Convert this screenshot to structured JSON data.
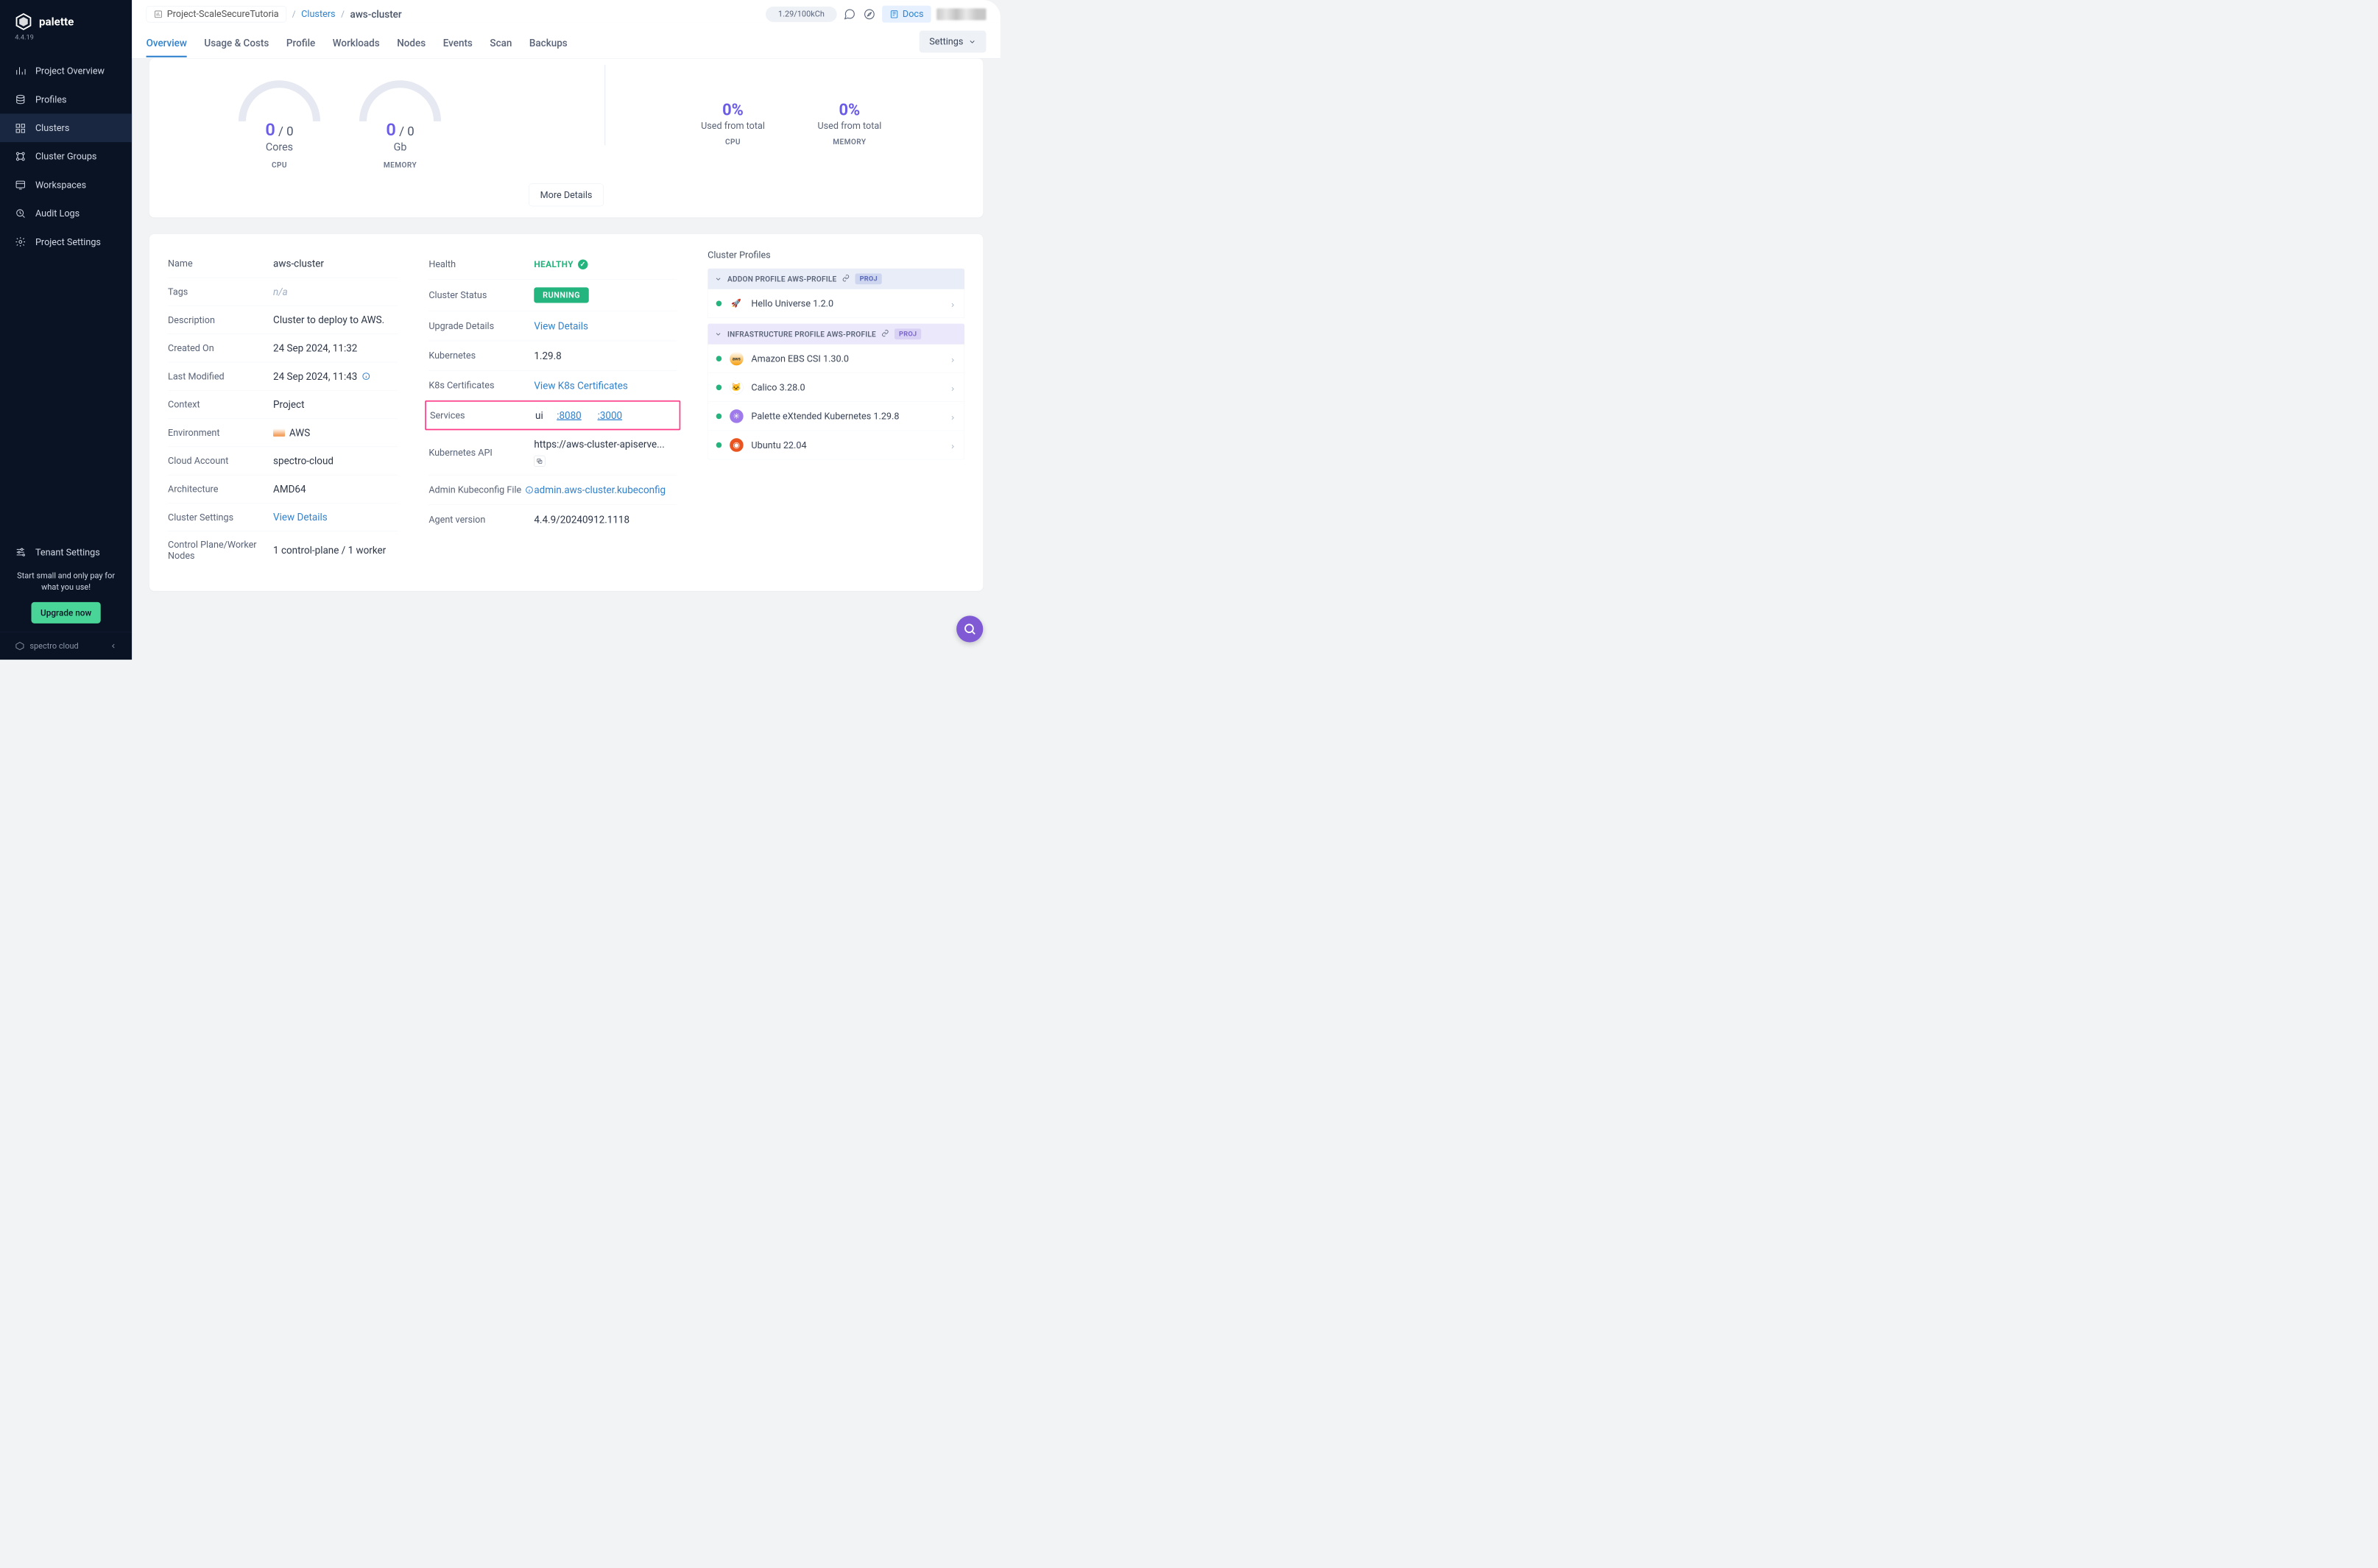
{
  "brand": {
    "name": "palette",
    "version": "4.4.19"
  },
  "sidebar": {
    "items": [
      {
        "label": "Project Overview"
      },
      {
        "label": "Profiles"
      },
      {
        "label": "Clusters"
      },
      {
        "label": "Cluster Groups"
      },
      {
        "label": "Workspaces"
      },
      {
        "label": "Audit Logs"
      },
      {
        "label": "Project Settings"
      }
    ],
    "tenant": "Tenant Settings",
    "promo": "Start small and only pay for what you use!",
    "upgrade": "Upgrade now",
    "footer": "spectro cloud"
  },
  "breadcrumb": {
    "project": "Project-ScaleSecureTutoria",
    "parent": "Clusters",
    "current": "aws-cluster"
  },
  "header": {
    "credits": "1.29/100kCh",
    "docs": "Docs"
  },
  "tabs": [
    {
      "label": "Overview",
      "active": true
    },
    {
      "label": "Usage & Costs"
    },
    {
      "label": "Profile"
    },
    {
      "label": "Workloads"
    },
    {
      "label": "Nodes"
    },
    {
      "label": "Events"
    },
    {
      "label": "Scan"
    },
    {
      "label": "Backups"
    }
  ],
  "settings": "Settings",
  "gauges": {
    "cpu": {
      "used": "0",
      "total": "0",
      "unit": "Cores",
      "label": "CPU"
    },
    "mem": {
      "used": "0",
      "total": "0",
      "unit": "Gb",
      "label": "MEMORY"
    },
    "pctCpu": {
      "value": "0%",
      "sub": "Used from total",
      "label": "CPU"
    },
    "pctMem": {
      "value": "0%",
      "sub": "Used from total",
      "label": "MEMORY"
    },
    "more": "More Details"
  },
  "left": {
    "name_k": "Name",
    "name_v": "aws-cluster",
    "tags_k": "Tags",
    "tags_v": "n/a",
    "desc_k": "Description",
    "desc_v": "Cluster to deploy to AWS.",
    "created_k": "Created On",
    "created_v": "24 Sep 2024, 11:32",
    "mod_k": "Last Modified",
    "mod_v": "24 Sep 2024, 11:43",
    "ctx_k": "Context",
    "ctx_v": "Project",
    "env_k": "Environment",
    "env_v": "AWS",
    "acct_k": "Cloud Account",
    "acct_v": "spectro-cloud",
    "arch_k": "Architecture",
    "arch_v": "AMD64",
    "cs_k": "Cluster Settings",
    "cs_v": "View Details",
    "nodes_k": "Control Plane/Worker Nodes",
    "nodes_v": "1 control-plane / 1 worker"
  },
  "mid": {
    "health_k": "Health",
    "health_v": "HEALTHY",
    "status_k": "Cluster Status",
    "status_v": "RUNNING",
    "upg_k": "Upgrade Details",
    "upg_v": "View Details",
    "k8s_k": "Kubernetes",
    "k8s_v": "1.29.8",
    "certs_k": "K8s Certificates",
    "certs_v": "View K8s Certificates",
    "svc_k": "Services",
    "svc_name": "ui",
    "svc_p1": ":8080",
    "svc_p2": ":3000",
    "api_k": "Kubernetes API",
    "api_v": "https://aws-cluster-apiserve...",
    "kube_k": "Admin Kubeconfig File",
    "kube_v": "admin.aws-cluster.kubeconfig",
    "agent_k": "Agent version",
    "agent_v": "4.4.9/20240912.1118"
  },
  "profiles": {
    "title": "Cluster Profiles",
    "addon_header": "ADDON PROFILE AWS-PROFILE",
    "infra_header": "INFRASTRUCTURE PROFILE AWS-PROFILE",
    "badge": "PROJ",
    "addon": [
      {
        "label": "Hello Universe 1.2.0"
      }
    ],
    "infra": [
      {
        "label": "Amazon EBS CSI 1.30.0"
      },
      {
        "label": "Calico 3.28.0"
      },
      {
        "label": "Palette eXtended Kubernetes 1.29.8"
      },
      {
        "label": "Ubuntu 22.04"
      }
    ]
  }
}
